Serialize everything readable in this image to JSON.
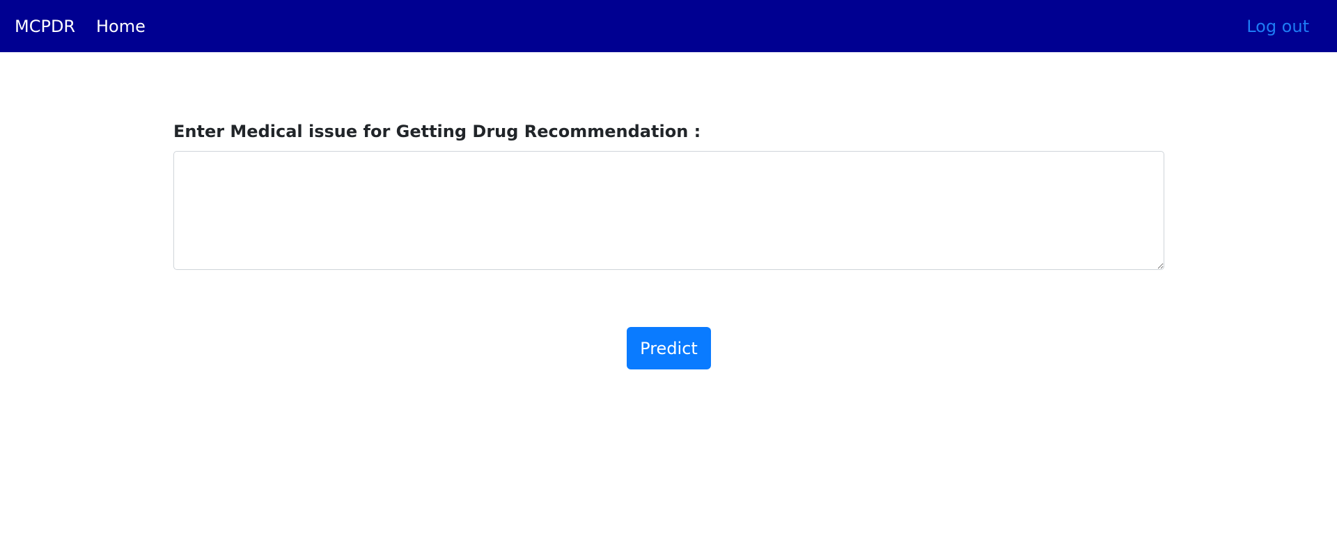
{
  "navbar": {
    "brand": "MCPDR",
    "home_label": "Home",
    "logout_label": "Log out",
    "background_color": "#000091",
    "logout_color": "#1e7cf5"
  },
  "form": {
    "label": "Enter Medical issue for Getting Drug Recommendation :",
    "textarea_value": "",
    "predict_label": "Predict",
    "button_color": "#0a7bff"
  }
}
